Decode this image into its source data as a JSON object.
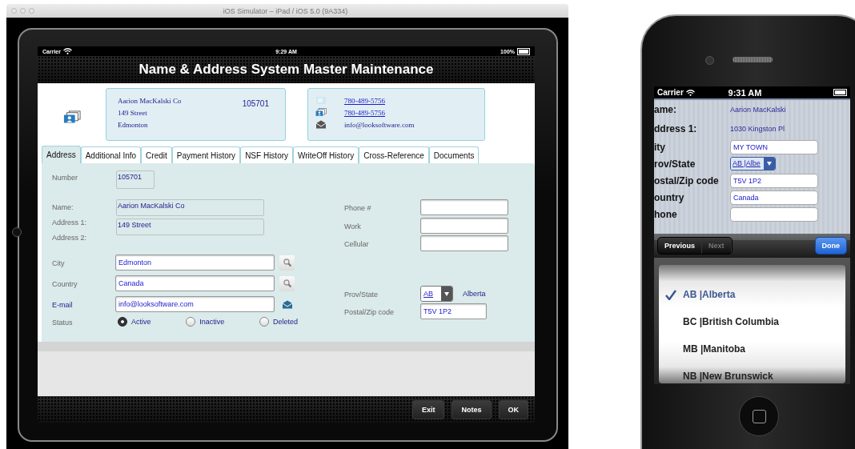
{
  "simulator_window": {
    "title": "iOS Simulator – iPad / iOS 5.0 (9A334)"
  },
  "ipad": {
    "status_bar": {
      "carrier": "Carrier",
      "time": "9:29 AM",
      "battery": "100%"
    },
    "header": {
      "title": "Name & Address System Master Maintenance"
    },
    "summary_card": {
      "name": "Aarion MacKalski Co",
      "street": "149 Street",
      "city": "Edmonton",
      "number": "105701"
    },
    "contact_card": {
      "phone": "780-489-5756",
      "work": "780-489-5756",
      "email": "info@looksoftware.com"
    },
    "tabs": [
      {
        "label": "Address",
        "selected": true
      },
      {
        "label": "Additional Info",
        "selected": false
      },
      {
        "label": "Credit",
        "selected": false
      },
      {
        "label": "Payment History",
        "selected": false
      },
      {
        "label": "NSF History",
        "selected": false
      },
      {
        "label": "WriteOff History",
        "selected": false
      },
      {
        "label": "Cross-Reference",
        "selected": false
      },
      {
        "label": "Documents",
        "selected": false
      }
    ],
    "form": {
      "number": {
        "label": "Number",
        "value": "105701"
      },
      "name": {
        "label": "Name:",
        "value": "Aarion MacKalski Co"
      },
      "address_1": {
        "label": "Address 1:",
        "value": "149 Street"
      },
      "address_2": {
        "label": "Address 2:"
      },
      "city": {
        "label": "City",
        "value": "Edmonton"
      },
      "country": {
        "label": "Country",
        "value": "Canada"
      },
      "email": {
        "label": "E-mail",
        "value": "info@looksoftware.com"
      },
      "status": {
        "label": "Status",
        "options": [
          {
            "label": "Active",
            "selected": true
          },
          {
            "label": "Inactive",
            "selected": false
          },
          {
            "label": "Deleted",
            "selected": false
          }
        ]
      },
      "phone": {
        "label": "Phone #"
      },
      "work": {
        "label": "Work"
      },
      "cellular": {
        "label": "Cellular"
      },
      "prov_state": {
        "label": "Prov/State",
        "value": "AB",
        "name": "Alberta"
      },
      "postal_code": {
        "label": "Postal/Zip code",
        "value": "T5V 1P2"
      }
    },
    "buttons": [
      "Exit",
      "Notes",
      "OK"
    ]
  },
  "iphone": {
    "status_bar": {
      "carrier": "Carrier",
      "time": "9:31 AM"
    },
    "rows": [
      {
        "kind": "text",
        "label": "ame:",
        "value": "Aarion MacKalski"
      },
      {
        "kind": "text",
        "label": "ddress 1:",
        "value": "1030 Kingston Pl"
      },
      {
        "kind": "field",
        "label": "ity",
        "value": "MY TOWN"
      },
      {
        "kind": "select",
        "label": "rov/State",
        "value": "AB |Albe"
      },
      {
        "kind": "field",
        "label": "ostal/Zip code",
        "value": "T5V 1P2"
      },
      {
        "kind": "field",
        "label": "ountry",
        "value": "Canada"
      },
      {
        "kind": "field",
        "label": "hone"
      }
    ],
    "nav_buttons": [
      {
        "label": "Previous",
        "disabled": false
      },
      {
        "label": "Next",
        "disabled": true
      }
    ],
    "done": "Done",
    "picker": [
      {
        "label": "AB |Alberta",
        "selected": true
      },
      {
        "label": "BC |British Columbia",
        "selected": false
      },
      {
        "label": "MB |Manitoba",
        "selected": false
      },
      {
        "label": "NB |New Brunswick",
        "selected": false
      }
    ]
  }
}
